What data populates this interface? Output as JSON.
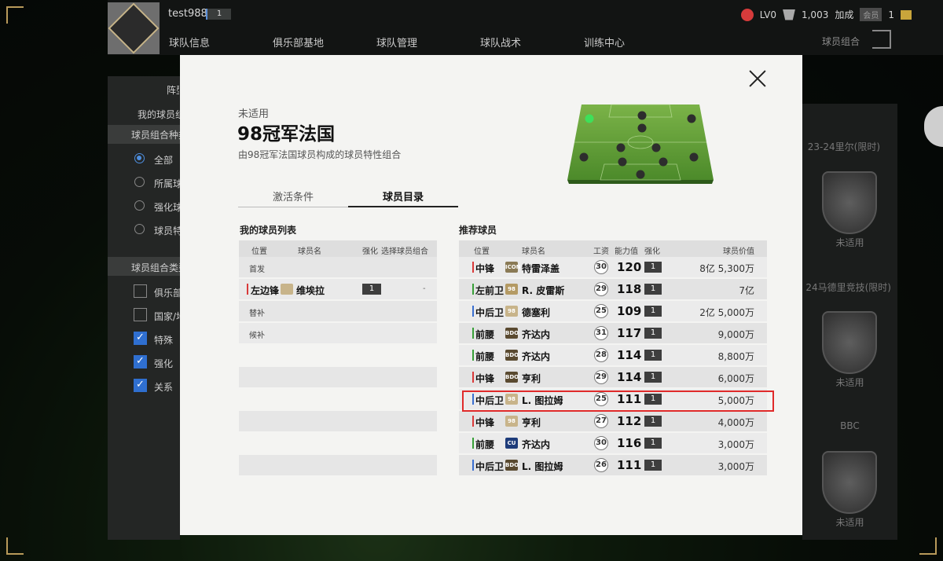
{
  "topbar": {
    "username": "test988",
    "level": "1",
    "lv_label": "LV0",
    "points": "1,003",
    "boost_label": "加成",
    "vip_badge": "会员",
    "gold": "1",
    "nav": [
      "球队信息",
      "俱乐部基地",
      "球队管理",
      "球队战术",
      "训练中心"
    ],
    "nav_right": "球员组合"
  },
  "left_panel": {
    "title": "阵型",
    "my_combos": "我的球员组合",
    "combo_kind_header": "球员组合种类",
    "radios": [
      {
        "label": "全部",
        "checked": true
      },
      {
        "label": "所属球队",
        "checked": false
      },
      {
        "label": "强化球员",
        "checked": false
      },
      {
        "label": "球员特性",
        "checked": false
      }
    ],
    "combo_type_header": "球员组合类型",
    "checkboxes": [
      {
        "label": "俱乐部",
        "checked": false
      },
      {
        "label": "国家/地区",
        "checked": false
      },
      {
        "label": "特殊",
        "checked": true
      },
      {
        "label": "强化",
        "checked": true
      },
      {
        "label": "关系",
        "checked": true
      }
    ]
  },
  "right_panel": {
    "items": [
      {
        "name": "23-24里尔(限时)",
        "status": "未适用"
      },
      {
        "name": "24马德里竞技(限时)",
        "status": "未适用"
      },
      {
        "name": "BBC",
        "status": "未适用"
      }
    ]
  },
  "modal": {
    "status": "未适用",
    "title": "98冠军法国",
    "description": "由98冠军法国球员构成的球员特性组合",
    "tabs": [
      "激活条件",
      "球员目录"
    ],
    "active_tab": "球员目录"
  },
  "my_list": {
    "title": "我的球员列表",
    "headers": {
      "pos": "位置",
      "name": "球员名",
      "enh": "强化",
      "select": "选择球员组合"
    },
    "group_starter": "首发",
    "group_sub": "替补",
    "group_reserve": "候补",
    "player": {
      "pos": "左边锋",
      "name": "维埃拉",
      "enh": "1",
      "select": "-",
      "pos_color": "#d93a3a"
    }
  },
  "recommended": {
    "title": "推荐球员",
    "headers": {
      "pos": "位置",
      "name": "球员名",
      "salary": "工资",
      "ovr": "能力值",
      "enh": "强化",
      "price": "球员价值"
    },
    "rows": [
      {
        "pos": "中锋",
        "pos_color": "#d93a3a",
        "season": "ICON",
        "season_color": "#8a7a55",
        "name": "特雷泽盖",
        "salary": "30",
        "ovr": "120",
        "enh": "1",
        "price": "8亿 5,300万"
      },
      {
        "pos": "左前卫",
        "pos_color": "#38a038",
        "season": "98",
        "season_color": "#b49a64",
        "name": "R. 皮雷斯",
        "salary": "29",
        "ovr": "118",
        "enh": "1",
        "price": "7亿"
      },
      {
        "pos": "中后卫",
        "pos_color": "#3a6fd0",
        "season": "98",
        "season_color": "#c8b48a",
        "name": "德塞利",
        "salary": "25",
        "ovr": "109",
        "enh": "1",
        "price": "2亿 5,000万"
      },
      {
        "pos": "前腰",
        "pos_color": "#38a038",
        "season": "BDO",
        "season_color": "#5a4a30",
        "name": "齐达内",
        "salary": "31",
        "ovr": "117",
        "enh": "1",
        "price": "9,000万"
      },
      {
        "pos": "前腰",
        "pos_color": "#38a038",
        "season": "BDO",
        "season_color": "#5a4a30",
        "name": "齐达内",
        "salary": "28",
        "ovr": "114",
        "enh": "1",
        "price": "8,800万"
      },
      {
        "pos": "中锋",
        "pos_color": "#d93a3a",
        "season": "BDO",
        "season_color": "#5a4a30",
        "name": "亨利",
        "salary": "29",
        "ovr": "114",
        "enh": "1",
        "price": "6,000万"
      },
      {
        "pos": "中后卫",
        "pos_color": "#3a6fd0",
        "season": "98",
        "season_color": "#c8b48a",
        "name": "L. 图拉姆",
        "salary": "25",
        "ovr": "111",
        "enh": "1",
        "price": "5,000万"
      },
      {
        "pos": "中锋",
        "pos_color": "#d93a3a",
        "season": "98",
        "season_color": "#c8b48a",
        "name": "亨利",
        "salary": "27",
        "ovr": "112",
        "enh": "1",
        "price": "4,000万"
      },
      {
        "pos": "前腰",
        "pos_color": "#38a038",
        "season": "CU",
        "season_color": "#1e3c7a",
        "name": "齐达内",
        "salary": "30",
        "ovr": "116",
        "enh": "1",
        "price": "3,000万"
      },
      {
        "pos": "中后卫",
        "pos_color": "#3a6fd0",
        "season": "BDO",
        "season_color": "#5a4a30",
        "name": "L. 图拉姆",
        "salary": "26",
        "ovr": "111",
        "enh": "1",
        "price": "3,000万"
      }
    ],
    "highlighted_row_index": 6
  }
}
